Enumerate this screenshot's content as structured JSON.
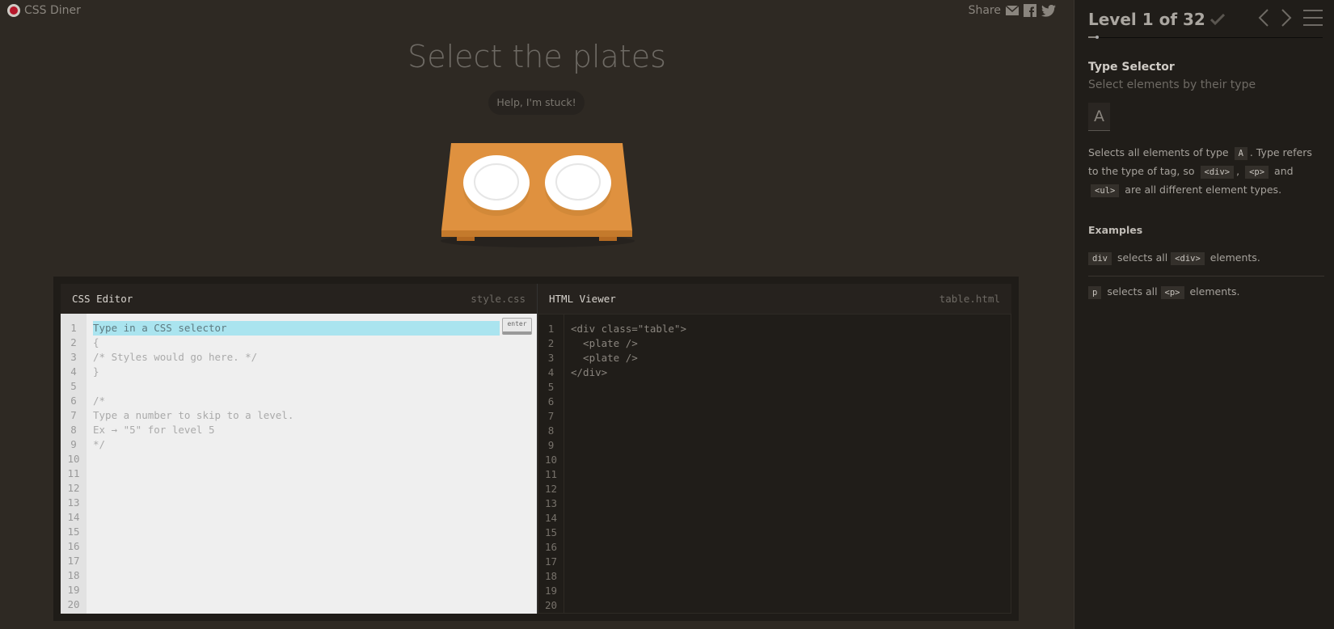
{
  "header": {
    "app_name": "CSS Diner",
    "share_label": "Share"
  },
  "main": {
    "instruction": "Select the plates",
    "help_button": "Help, I'm stuck!"
  },
  "css_editor": {
    "title": "CSS Editor",
    "filename": "style.css",
    "input_placeholder": "Type in a CSS selector",
    "enter_button": "enter",
    "lines": [
      "",
      "{",
      "/* Styles would go here. */",
      "}",
      "",
      "/*",
      "Type a number to skip to a level.",
      "Ex → \"5\" for level 5",
      "*/",
      "",
      "",
      "",
      "",
      "",
      "",
      "",
      "",
      "",
      "",
      ""
    ],
    "line_numbers": [
      "1",
      "2",
      "3",
      "4",
      "5",
      "6",
      "7",
      "8",
      "9",
      "10",
      "11",
      "12",
      "13",
      "14",
      "15",
      "16",
      "17",
      "18",
      "19",
      "20"
    ]
  },
  "html_viewer": {
    "title": "HTML Viewer",
    "filename": "table.html",
    "lines": [
      "<div class=\"table\">",
      "  <plate />",
      "  <plate />",
      "</div>"
    ],
    "line_numbers": [
      "1",
      "2",
      "3",
      "4",
      "5",
      "6",
      "7",
      "8",
      "9",
      "10",
      "11",
      "12",
      "13",
      "14",
      "15",
      "16",
      "17",
      "18",
      "19",
      "20"
    ]
  },
  "sidebar": {
    "level_label": "Level 1 of 32",
    "progress": 0.03125,
    "selector_name": "Type Selector",
    "selector_subtitle": "Select elements by their type",
    "syntax": "A",
    "desc": {
      "p1": "Selects all elements of type",
      "c1": "A",
      "p2": ". Type refers to the type of tag, so",
      "c2": "<div>",
      "p3": ",",
      "c3": "<p>",
      "p4": "and",
      "c4": "<ul>",
      "p5": "are all different element types."
    },
    "examples_title": "Examples",
    "examples": [
      {
        "code": "div",
        "text": "selects all",
        "tag": "<div>",
        "suffix": "elements."
      },
      {
        "code": "p",
        "text": "selects all",
        "tag": "<p>",
        "suffix": "elements."
      }
    ]
  }
}
